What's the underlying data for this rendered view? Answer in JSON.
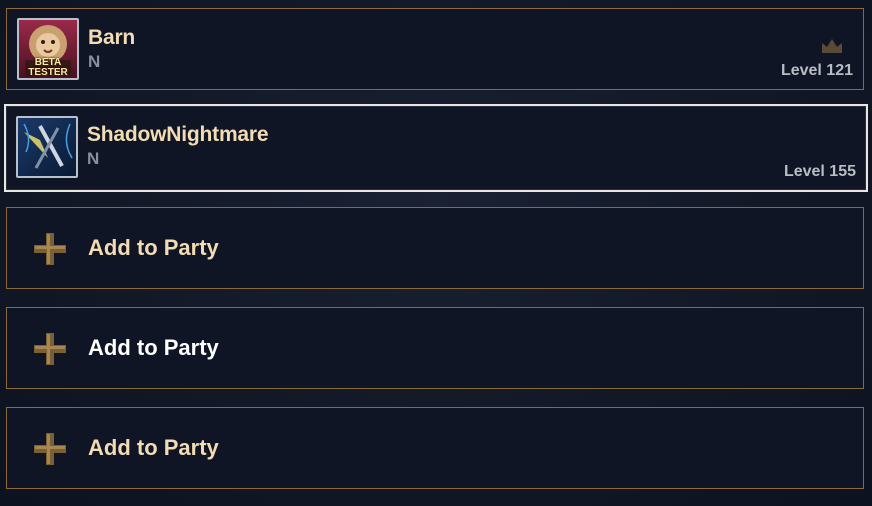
{
  "party": {
    "members": [
      {
        "name": "Barn",
        "rank": "N",
        "level": "Level 121",
        "badge_text": "BETA TESTER",
        "portrait_icon": "lion-portrait-icon",
        "leader": true
      },
      {
        "name": "ShadowNightmare",
        "rank": "N",
        "level": "Level 155",
        "portrait_icon": "weapon-portrait-icon",
        "leader": false
      }
    ],
    "empty_slots": [
      {
        "label": "Add to Party",
        "icon": "plus-icon"
      },
      {
        "label": "Add to Party",
        "icon": "plus-icon"
      },
      {
        "label": "Add to Party",
        "icon": "plus-icon"
      }
    ],
    "colors": {
      "accent_gold": "#8a6a36",
      "name_text": "#f2dcb4",
      "selected_border": "#e8e6e0"
    }
  }
}
